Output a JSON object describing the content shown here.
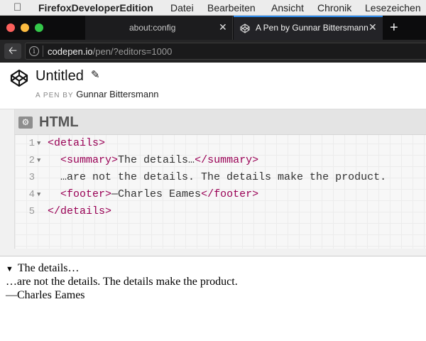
{
  "menubar": {
    "app_name": "FirefoxDeveloperEdition",
    "items": [
      "Datei",
      "Bearbeiten",
      "Ansicht",
      "Chronik",
      "Lesezeichen"
    ]
  },
  "tabs": [
    {
      "label": "about:config",
      "active": false
    },
    {
      "label": "A Pen by Gunnar Bittersmann",
      "active": true
    }
  ],
  "navbar": {
    "url_host": "codepen.io",
    "url_path": "/pen/?editors=1000"
  },
  "pen": {
    "title": "Untitled",
    "by_prefix": "A PEN BY",
    "author": "Gunnar Bittersmann"
  },
  "editor": {
    "title": "HTML",
    "lines": [
      {
        "num": "1",
        "foldable": true,
        "parts": [
          {
            "t": "<details>",
            "c": "tag"
          }
        ]
      },
      {
        "num": "2",
        "foldable": true,
        "parts": [
          {
            "t": "  ",
            "c": "txt"
          },
          {
            "t": "<summary>",
            "c": "tag"
          },
          {
            "t": "The details…",
            "c": "txt"
          },
          {
            "t": "</summary>",
            "c": "tag"
          }
        ]
      },
      {
        "num": "3",
        "foldable": false,
        "parts": [
          {
            "t": "  …are not the details. The details make the product.",
            "c": "txt"
          }
        ]
      },
      {
        "num": "4",
        "foldable": true,
        "parts": [
          {
            "t": "  ",
            "c": "txt"
          },
          {
            "t": "<footer>",
            "c": "tag"
          },
          {
            "t": "—Charles Eames",
            "c": "txt"
          },
          {
            "t": "</footer>",
            "c": "tag"
          }
        ]
      },
      {
        "num": "5",
        "foldable": false,
        "parts": [
          {
            "t": "</details>",
            "c": "tag"
          }
        ]
      }
    ]
  },
  "preview": {
    "summary": "The details…",
    "body": "…are not the details. The details make the product.",
    "footer": "—Charles Eames"
  },
  "colors": {
    "tag": "#990055",
    "active_tab_indicator": "#2d8cf0",
    "traffic_red": "#fc605c",
    "traffic_yellow": "#fdbc40",
    "traffic_green": "#34c84a"
  }
}
